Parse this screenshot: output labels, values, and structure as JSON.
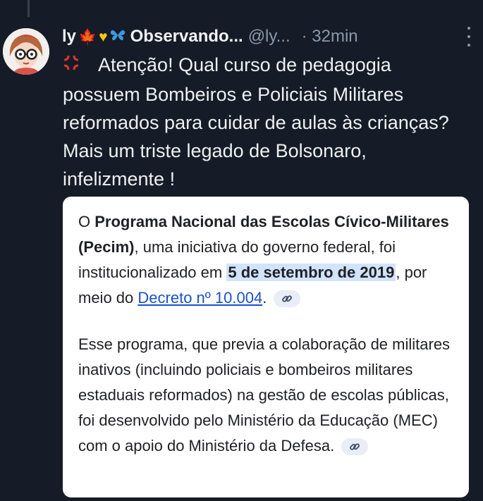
{
  "author": {
    "name_prefix": "ly",
    "emoji": [
      "maple-leaf",
      "yellow-heart",
      "butterfly"
    ],
    "name_suffix": "Observando...",
    "handle": "@ly...",
    "time": "· 32min"
  },
  "post": {
    "text": "Atenção! Qual curso de pedagogia possuem Bombeiros e Policiais Militares reformados para cuidar de aulas às crianças? Mais um triste legado de Bolsonaro, infelizmente !"
  },
  "card": {
    "p1_pre": "O ",
    "p1_bold": "Programa Nacional das Escolas Cívico-Militares (Pecim)",
    "p1_mid": ", uma iniciativa do governo federal, foi institucionalizado em ",
    "p1_highlight": "5 de setembro de 2019",
    "p1_mid2": ", por meio do ",
    "p1_link": "Decreto nº 10.004",
    "p1_end": ".",
    "p2_text": "Esse programa, que previa a colaboração de militares inativos (incluindo policiais e bombeiros militares estaduais reformados) na gestão de escolas públicas, foi desenvolvido pelo Ministério da Educação (MEC) com o apoio do Ministério da Defesa."
  },
  "colors": {
    "background": "#151c27",
    "handle_gray": "#8b98a5",
    "link_blue": "#1a50c8",
    "highlight": "#d2e3fc"
  }
}
